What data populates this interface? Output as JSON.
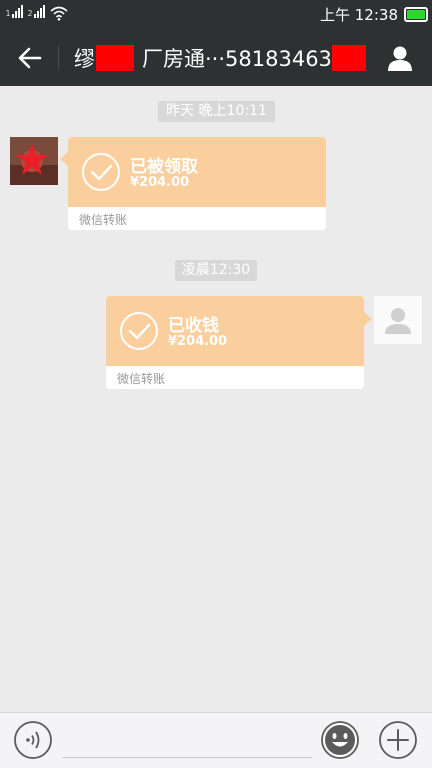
{
  "status_bar": {
    "sim1_index": "1",
    "sim2_index": "2",
    "time": "上午 12:38"
  },
  "nav": {
    "title_prefix": "缪",
    "title_middle": "厂房通···58183463"
  },
  "messages": [
    {
      "timestamp": "昨天 晚上10:11",
      "side": "left",
      "status": "已被领取",
      "amount": "¥204.00",
      "footer": "微信转账"
    },
    {
      "timestamp": "凌晨12:30",
      "side": "right",
      "status": "已收钱",
      "amount": "¥204.00",
      "footer": "微信转账"
    }
  ],
  "colors": {
    "bar": "#2e3132",
    "chat_bg": "#ebebeb",
    "transfer_card": "#fbcf9d",
    "redaction": "#ff0000",
    "battery": "#2bd82b"
  },
  "icons": [
    "back-arrow-icon",
    "profile-icon",
    "check-circle-icon",
    "voice-icon",
    "emoji-icon",
    "plus-icon",
    "wifi-icon",
    "battery-icon"
  ]
}
